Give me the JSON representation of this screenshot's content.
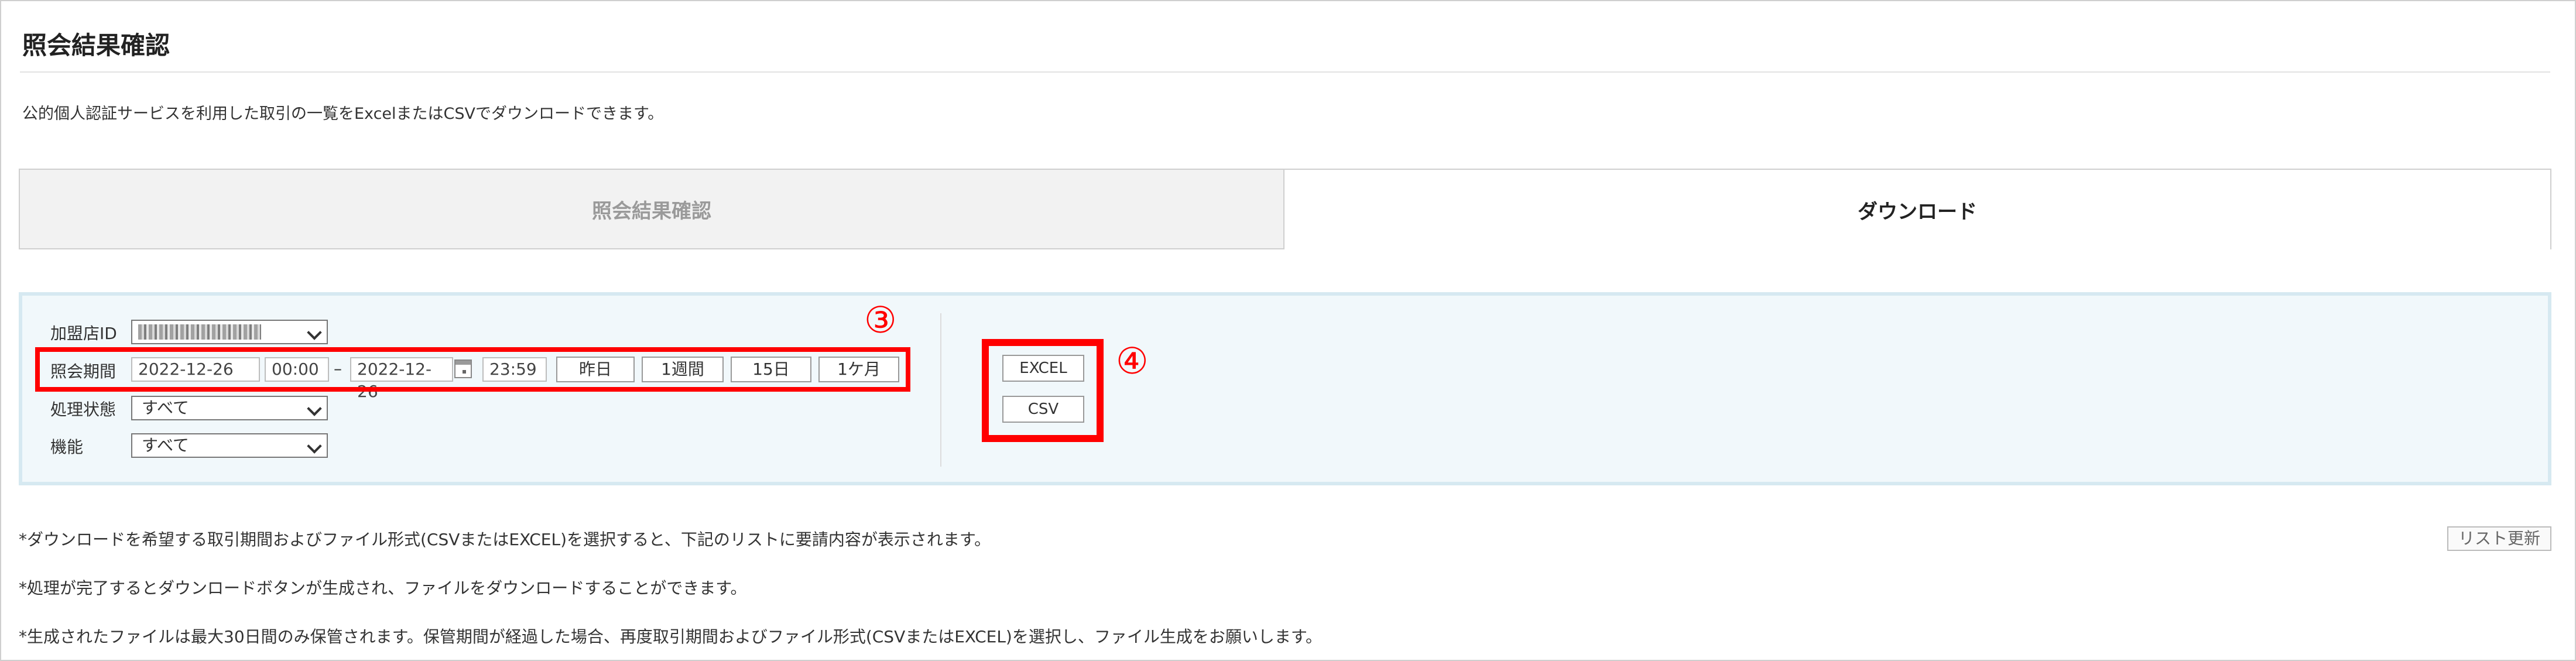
{
  "page": {
    "title": "照会結果確認",
    "description": "公的個人認証サービスを利用した取引の一覧をExcelまたはCSVでダウンロードできます。"
  },
  "tabs": [
    {
      "label": "照会結果確認",
      "active": false
    },
    {
      "label": "ダウンロード",
      "active": true
    }
  ],
  "form": {
    "merchant_id_label": "加盟店ID",
    "period_label": "照会期間",
    "status_label": "処理状態",
    "status_value": "すべて",
    "function_label": "機能",
    "function_value": "すべて",
    "start_date": "2022-12-26",
    "start_time": "00:00",
    "separator": "–",
    "end_date": "2022-12-26",
    "end_time": "23:59",
    "quick_buttons": [
      "昨日",
      "1週間",
      "15日",
      "1ケ月"
    ]
  },
  "annotations": {
    "marker3": "③",
    "marker4": "④"
  },
  "download": {
    "excel_label": "EXCEL",
    "csv_label": "CSV"
  },
  "notes": [
    "*ダウンロードを希望する取引期間およびファイル形式(CSVまたはEXCEL)を選択すると、下記のリストに要請内容が表示されます。",
    "*処理が完了するとダウンロードボタンが生成され、ファイルをダウンロードすることができます。",
    "*生成されたファイルは最大30日間のみ保管されます。保管期間が経過した場合、再度取引期間およびファイル形式(CSVまたはEXCEL)を選択し、ファイル生成をお願いします。"
  ],
  "refresh_label": "リスト更新",
  "colors": {
    "annotation": "#ff0000",
    "panel_bg": "#f1f8fb",
    "panel_border": "#d6e9f1"
  },
  "icons": {
    "calendar": "calendar-icon",
    "dropdown": "chevron-down-icon"
  }
}
